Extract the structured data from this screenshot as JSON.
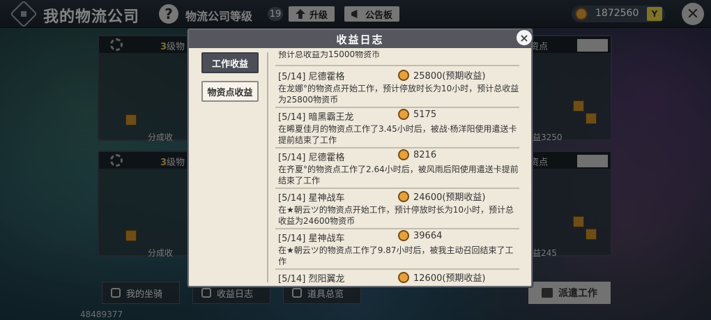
{
  "header": {
    "title": "我的物流公司",
    "help_icon": "?",
    "level_label": "物流公司等级",
    "level_value": "19",
    "upgrade_label": "升级",
    "notice_label": "公告板",
    "coins": "1872560",
    "coin_add_label": "Y"
  },
  "background": {
    "cards": [
      {
        "level": "3",
        "level_text": "级物",
        "caption": "分成收"
      },
      {
        "level": "",
        "level_text": "资点",
        "caption": "益3250"
      },
      {
        "level": "3",
        "level_text": "级物",
        "caption": "分成收"
      },
      {
        "level": "",
        "level_text": "资点",
        "caption": "益245"
      }
    ],
    "bottom_buttons": [
      {
        "label": "我的坐骑"
      },
      {
        "label": "收益日志"
      },
      {
        "label": "道具总览"
      }
    ],
    "dispatch_label": "派遣工作",
    "uid": "48489377"
  },
  "modal": {
    "title": "收益日志",
    "close_icon": "×",
    "tabs": [
      {
        "label": "工作收益",
        "active": true
      },
      {
        "label": "物资点收益",
        "active": false
      }
    ],
    "entries": [
      {
        "head": "",
        "amount": "",
        "desc": "预计总收益为15000物资币"
      },
      {
        "head": "[5/14] 尼德霍格",
        "amount": "25800(预期收益)",
        "desc": "在龙娜°的物资点开始工作，预计停放时长为10小时，预计总收益为25800物资币"
      },
      {
        "head": "[5/14] 暗黑霸王龙",
        "amount": "5175",
        "desc": "在晞夏佳月的物资点工作了3.45小时后，被战·杨洋阳使用遣送卡提前结束了工作"
      },
      {
        "head": "[5/14] 尼德霍格",
        "amount": "8216",
        "desc": "在齐夏°的物资点工作了2.64小时后，被风雨后阳使用遣送卡提前结束了工作"
      },
      {
        "head": "[5/14] 星神战车",
        "amount": "24600(预期收益)",
        "desc": "在★朝云ツ的物资点开始工作，预计停放时长为10小时，预计总收益为24600物资币"
      },
      {
        "head": "[5/14] 星神战车",
        "amount": "39664",
        "desc": "在★朝云ツ的物资点工作了9.87小时后，被我主动召回结束了工作"
      },
      {
        "head": "[5/14] 烈阳翼龙",
        "amount": "12600(预期收益)",
        "desc": ""
      }
    ]
  }
}
